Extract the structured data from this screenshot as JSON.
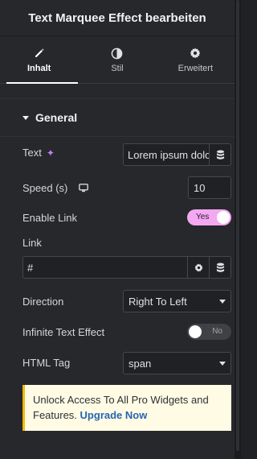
{
  "header": {
    "title": "Text Marquee Effect bearbeiten"
  },
  "tabs": [
    {
      "label": "Inhalt",
      "icon": "pencil-icon",
      "active": true
    },
    {
      "label": "Stil",
      "icon": "half-circle-icon",
      "active": false
    },
    {
      "label": "Erweitert",
      "icon": "gear-icon",
      "active": false
    }
  ],
  "section": {
    "title": "General"
  },
  "fields": {
    "text": {
      "label": "Text",
      "value": "Lorem ipsum dolo"
    },
    "speed": {
      "label": "Speed (s)",
      "value": "10"
    },
    "enable_link": {
      "label": "Enable Link",
      "state": "Yes"
    },
    "link": {
      "label": "Link",
      "value": "#"
    },
    "direction": {
      "label": "Direction",
      "value": "Right To Left"
    },
    "infinite": {
      "label": "Infinite Text Effect",
      "state": "No"
    },
    "html_tag": {
      "label": "HTML Tag",
      "value": "span"
    }
  },
  "promo": {
    "text": "Unlock Access To All Pro Widgets and Features.",
    "link": "Upgrade Now"
  },
  "colors": {
    "toggle_on": "#f3a8f1",
    "accent_link": "#2566b3",
    "promo_border": "#f0b90b"
  }
}
